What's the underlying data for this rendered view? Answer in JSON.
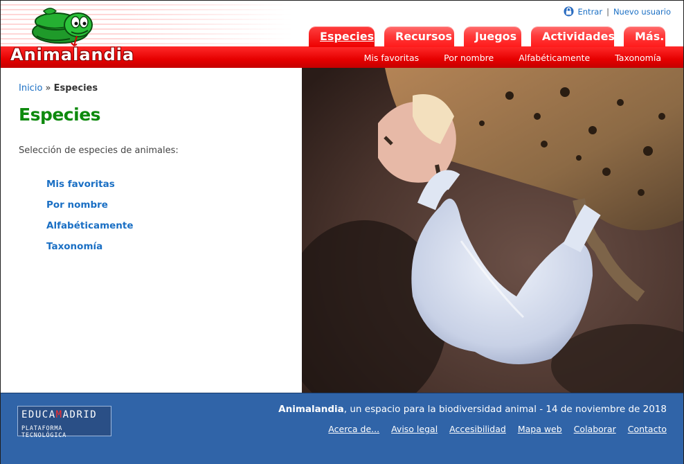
{
  "brand": {
    "name": "Animalandia"
  },
  "user_links": {
    "login": "Entrar",
    "separator": "|",
    "register": "Nuevo usuario"
  },
  "tabs": [
    {
      "label": "Especies",
      "active": true
    },
    {
      "label": "Recursos",
      "active": false
    },
    {
      "label": "Juegos",
      "active": false
    },
    {
      "label": "Actividades",
      "active": false
    },
    {
      "label": "Más...",
      "active": false
    }
  ],
  "subnav": [
    "Mis favoritas",
    "Por nombre",
    "Alfabéticamente",
    "Taxonomía"
  ],
  "breadcrumb": {
    "home": "Inicio",
    "separator": "»",
    "current": "Especies"
  },
  "page": {
    "title": "Especies",
    "intro": "Selección de especies de animales:",
    "links": [
      "Mis favoritas",
      "Por nombre",
      "Alfabéticamente",
      "Taxonomía"
    ]
  },
  "footer": {
    "logo_title_prefix": "EDUCA",
    "logo_title_m": "M",
    "logo_title_suffix": "ADRID",
    "logo_subtitle": "PLATAFORMA TECNOLÓGICA",
    "tagline_brand": "Animalandia",
    "tagline_rest": ", un espacio para la biodiversidad animal - 14 de noviembre de 2018",
    "links": [
      "Acerca de...",
      "Aviso legal",
      "Accesibilidad",
      "Mapa web",
      "Colaborar",
      "Contacto"
    ]
  },
  "colors": {
    "header_red": "#e60000",
    "title_green": "#0e8a0e",
    "link_blue": "#1a6fc4",
    "footer_blue": "#3064a8"
  },
  "icons": [
    "snake-mascot-icon",
    "user-icon"
  ]
}
